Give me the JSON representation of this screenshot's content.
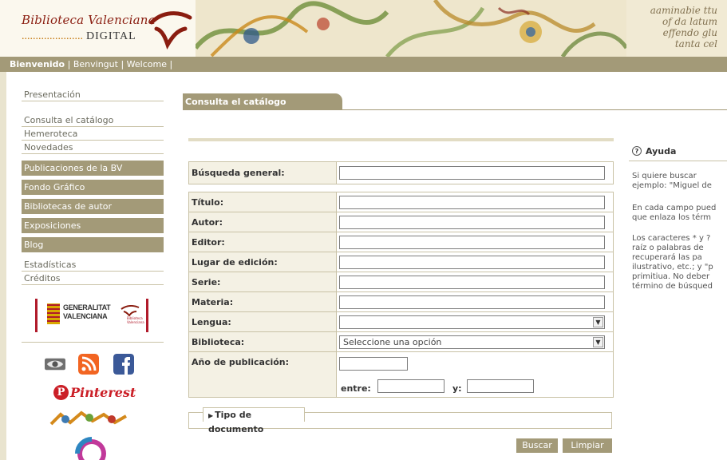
{
  "header": {
    "logo_title": "Biblioteca Valenciana",
    "logo_dots": "......................",
    "logo_subtitle": "DIGITAL",
    "banner_text_line1": "aaminabie ttu",
    "banner_text_line2": "of da latum",
    "banner_text_line3": "effendo glu",
    "banner_text_line4": "tanta cel"
  },
  "welcome_bar": {
    "items": [
      "Bienvenido",
      "Benvingut",
      "Welcome"
    ],
    "separator": "|"
  },
  "sidebar": {
    "items": [
      {
        "label": "Presentación",
        "style": "light"
      },
      {
        "label": "Consulta el catálogo",
        "style": "light"
      },
      {
        "label": "Hemeroteca",
        "style": "light"
      },
      {
        "label": "Novedades",
        "style": "light"
      },
      {
        "label": "Publicaciones de la BV",
        "style": "dark"
      },
      {
        "label": "Fondo Gráfico",
        "style": "dark"
      },
      {
        "label": "Bibliotecas de autor",
        "style": "dark"
      },
      {
        "label": "Exposiciones",
        "style": "dark"
      },
      {
        "label": "Blog",
        "style": "dark"
      },
      {
        "label": "Estadísticas",
        "style": "light"
      },
      {
        "label": "Créditos",
        "style": "light"
      }
    ],
    "gva_line1": "GENERALITAT",
    "gva_line2": "VALENCIANA",
    "gva_sub_line1": "Biblioteca",
    "gva_sub_line2": "Valenciana",
    "pinterest_label": "Pinterest",
    "colors": {
      "facebook": "#3b5998",
      "rss": "#f26522",
      "pinterest": "#cb1f27"
    }
  },
  "main": {
    "tab_label": "Consulta el catálogo",
    "general_search_label": "Búsqueda general:",
    "fields": [
      {
        "label": "Título:",
        "value": ""
      },
      {
        "label": "Autor:",
        "value": ""
      },
      {
        "label": "Editor:",
        "value": ""
      },
      {
        "label": "Lugar de edición:",
        "value": ""
      },
      {
        "label": "Serie:",
        "value": ""
      },
      {
        "label": "Materia:",
        "value": ""
      }
    ],
    "lengua_label": "Lengua:",
    "lengua_value": "",
    "biblioteca_label": "Biblioteca:",
    "biblioteca_value": "Seleccione una opción",
    "anio_label": "Año de publicación:",
    "entre_label": "entre:",
    "y_label": "y:",
    "tipo_documento_label": "Tipo de documento",
    "buscar_label": "Buscar",
    "limpiar_label": "Limpiar"
  },
  "help": {
    "title": "Ayuda",
    "paragraphs": [
      [
        "Si quiere buscar",
        "ejemplo: \"Miguel de"
      ],
      [
        "En cada campo pued",
        "que enlaza los térm"
      ],
      [
        "Los caracteres * y ?",
        "raíz o palabras de",
        "recuperará las pa",
        "ilustrativo, etc.; y \"p",
        "primitiua. No deber",
        "término de búsqued"
      ]
    ]
  },
  "colors": {
    "accent": "#a39a78",
    "brand_red": "#8a1d10"
  }
}
